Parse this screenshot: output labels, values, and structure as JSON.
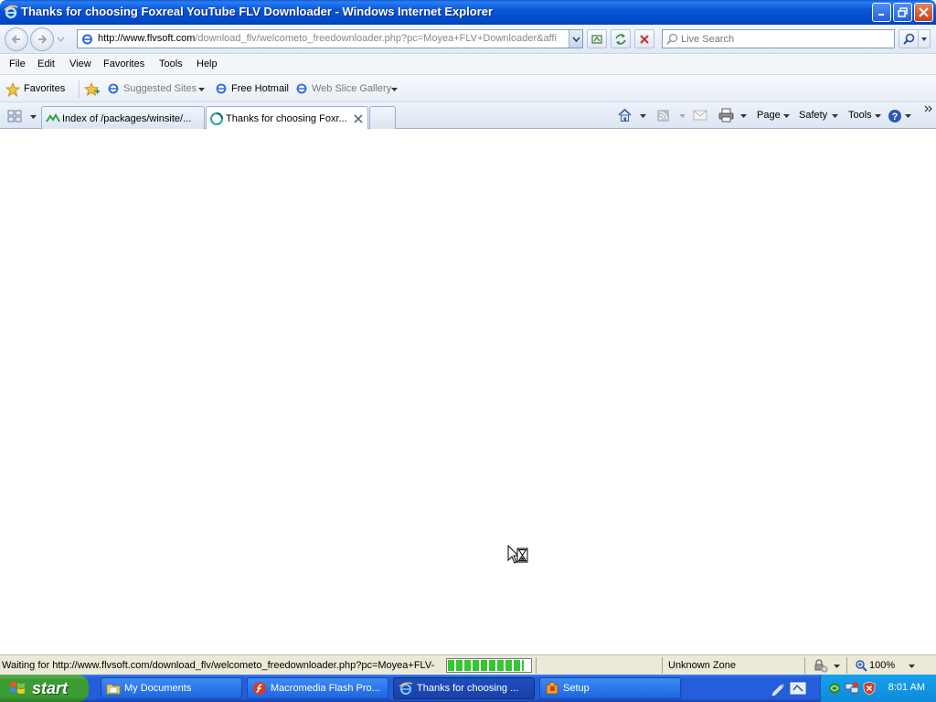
{
  "window": {
    "title": "Thanks for choosing Foxreal YouTube FLV Downloader - Windows Internet Explorer"
  },
  "nav": {
    "url_domain": "http://www.flvsoft.com",
    "url_path": "/download_flv/welcometo_freedownloader.php?pc=Moyea+FLV+Downloader&affi",
    "search_placeholder": "Live Search"
  },
  "menu": {
    "items": [
      "File",
      "Edit",
      "View",
      "Favorites",
      "Tools",
      "Help"
    ]
  },
  "favorites_bar": {
    "favorites_label": "Favorites",
    "items": [
      {
        "label": "Suggested Sites"
      },
      {
        "label": "Free Hotmail"
      },
      {
        "label": "Web Slice Gallery"
      }
    ]
  },
  "tabs": [
    {
      "label": "Index of /packages/winsite/..."
    },
    {
      "label": "Thanks for choosing Foxr..."
    }
  ],
  "command_bar": {
    "page_label": "Page",
    "safety_label": "Safety",
    "tools_label": "Tools"
  },
  "status": {
    "text": "Waiting for http://www.flvsoft.com/download_flv/welcometo_freedownloader.php?pc=Moyea+FLV-",
    "progress_fraction": 0.92,
    "zone": "Unknown Zone",
    "zoom": "100%"
  },
  "taskbar": {
    "start_label": "start",
    "items": [
      {
        "label": "My Documents"
      },
      {
        "label": "Macromedia Flash Pro..."
      },
      {
        "label": "Thanks for choosing ..."
      },
      {
        "label": "Setup"
      }
    ],
    "clock": "8:01 AM"
  },
  "colors": {
    "titlebar": "#0a56d6",
    "taskbar": "#245edb",
    "start_button": "#3c9c34",
    "progress": "#32c732",
    "tray": "#0e8ad8"
  }
}
